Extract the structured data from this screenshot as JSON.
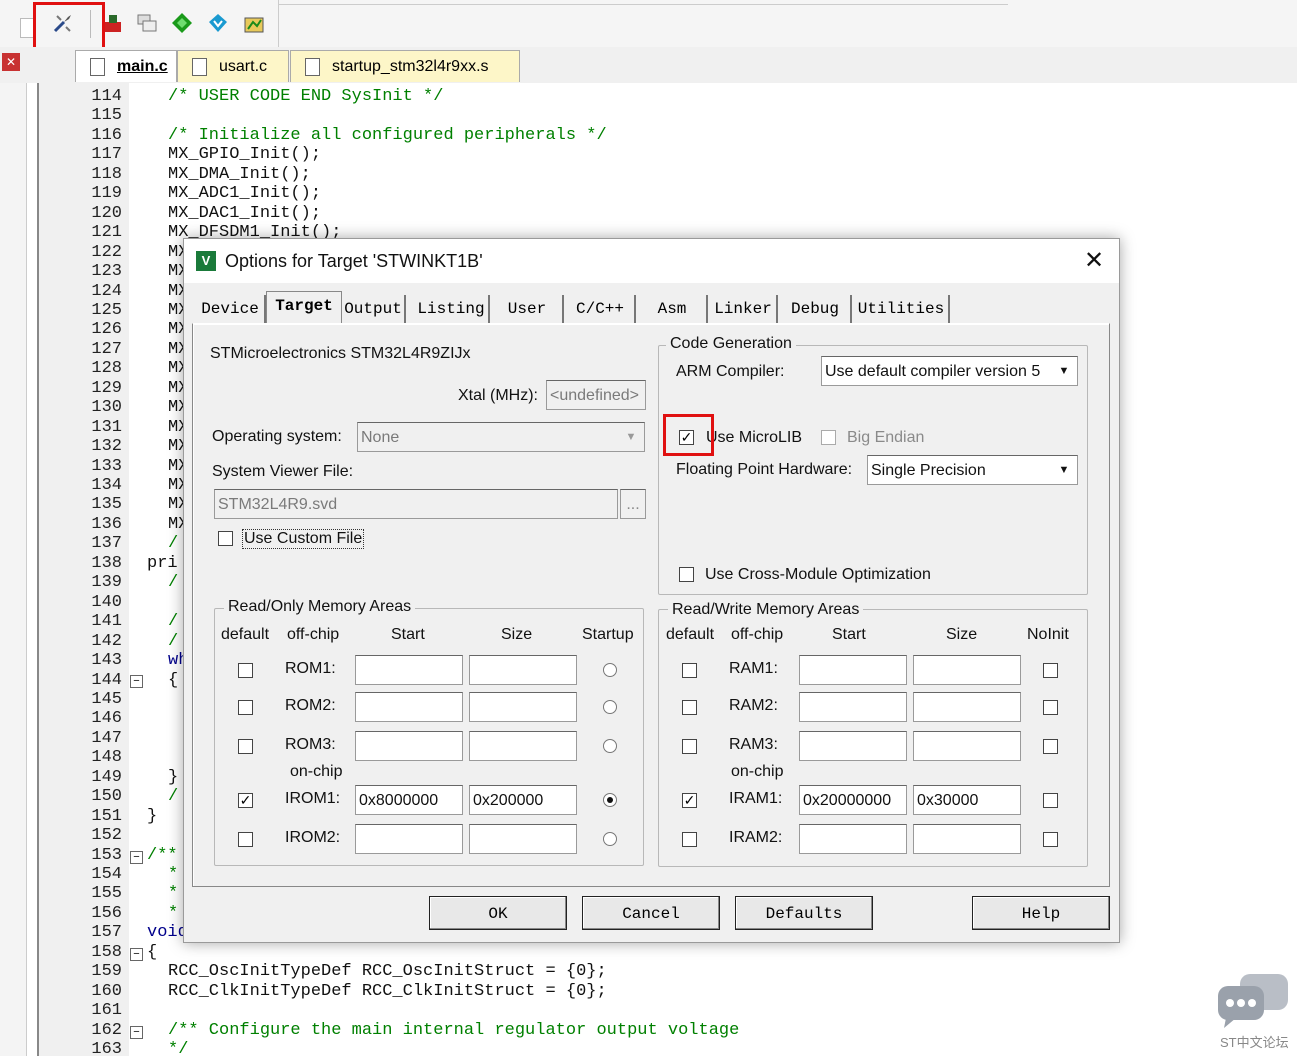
{
  "tabs": [
    {
      "label": "main.c"
    },
    {
      "label": "usart.c"
    },
    {
      "label": "startup_stm32l4r9xx.s"
    }
  ],
  "toolbar_icons": [
    "options-for-target-icon",
    "load-icon",
    "window-icon",
    "green-diamond-icon",
    "download-icon",
    "build-icon"
  ],
  "editor": {
    "lines": [
      {
        "n": "114",
        "t": "/* USER CODE END SysInit */",
        "c": "cmt"
      },
      {
        "n": "115",
        "t": "",
        "c": ""
      },
      {
        "n": "116",
        "t": "/* Initialize all configured peripherals */",
        "c": "cmt"
      },
      {
        "n": "117",
        "t": "MX_GPIO_Init();",
        "c": ""
      },
      {
        "n": "118",
        "t": "MX_DMA_Init();",
        "c": ""
      },
      {
        "n": "119",
        "t": "MX_ADC1_Init();",
        "c": ""
      },
      {
        "n": "120",
        "t": "MX_DAC1_Init();",
        "c": ""
      },
      {
        "n": "121",
        "t": "MX_DFSDM1_Init();",
        "c": ""
      },
      {
        "n": "122",
        "t": "MX",
        "c": ""
      },
      {
        "n": "123",
        "t": "MX",
        "c": ""
      },
      {
        "n": "124",
        "t": "MX",
        "c": ""
      },
      {
        "n": "125",
        "t": "MX",
        "c": ""
      },
      {
        "n": "126",
        "t": "MX",
        "c": ""
      },
      {
        "n": "127",
        "t": "MX",
        "c": ""
      },
      {
        "n": "128",
        "t": "MX",
        "c": ""
      },
      {
        "n": "129",
        "t": "MX",
        "c": ""
      },
      {
        "n": "130",
        "t": "MX",
        "c": ""
      },
      {
        "n": "131",
        "t": "MX",
        "c": ""
      },
      {
        "n": "132",
        "t": "MX",
        "c": ""
      },
      {
        "n": "133",
        "t": "MX",
        "c": ""
      },
      {
        "n": "134",
        "t": "MX",
        "c": ""
      },
      {
        "n": "135",
        "t": "MX",
        "c": ""
      },
      {
        "n": "136",
        "t": "MX",
        "c": ""
      },
      {
        "n": "137",
        "t": "/",
        "c": "cmt"
      },
      {
        "n": "138",
        "t": "pri",
        "c": "out"
      },
      {
        "n": "139",
        "t": "/",
        "c": "cmt"
      },
      {
        "n": "140",
        "t": "",
        "c": ""
      },
      {
        "n": "141",
        "t": "/",
        "c": "cmt"
      },
      {
        "n": "142",
        "t": "/",
        "c": "cmt"
      },
      {
        "n": "143",
        "t": "wh",
        "c": "kw"
      },
      {
        "n": "144",
        "t": "{",
        "c": ""
      },
      {
        "n": "145",
        "t": "",
        "c": ""
      },
      {
        "n": "146",
        "t": "",
        "c": ""
      },
      {
        "n": "147",
        "t": "",
        "c": ""
      },
      {
        "n": "148",
        "t": "",
        "c": ""
      },
      {
        "n": "149",
        "t": "}",
        "c": ""
      },
      {
        "n": "150",
        "t": "/",
        "c": "cmt"
      },
      {
        "n": "151",
        "t": "}",
        "c": "out"
      },
      {
        "n": "152",
        "t": "",
        "c": ""
      },
      {
        "n": "153",
        "t": "/**",
        "c": "cmtout"
      },
      {
        "n": "154",
        "t": "*",
        "c": "cmt"
      },
      {
        "n": "155",
        "t": "*",
        "c": "cmt"
      },
      {
        "n": "156",
        "t": "*",
        "c": "cmt"
      },
      {
        "n": "157",
        "t": "void",
        "c": "kwout"
      },
      {
        "n": "158",
        "t": "{",
        "c": "out"
      },
      {
        "n": "159",
        "t": "RCC_OscInitTypeDef RCC_OscInitStruct = {0};",
        "c": ""
      },
      {
        "n": "160",
        "t": "RCC_ClkInitTypeDef RCC_ClkInitStruct = {0};",
        "c": ""
      },
      {
        "n": "161",
        "t": "",
        "c": ""
      },
      {
        "n": "162",
        "t": "/** Configure the main internal regulator output voltage",
        "c": "cmt"
      },
      {
        "n": "163",
        "t": "*/",
        "c": "cmt"
      }
    ]
  },
  "dialog": {
    "title": "Options for Target 'STWINKT1B'",
    "tabs": [
      "Device",
      "Target",
      "Output",
      "Listing",
      "User",
      "C/C++",
      "Asm",
      "Linker",
      "Debug",
      "Utilities"
    ],
    "active_tab": "Target",
    "device": "STMicroelectronics STM32L4R9ZIJx",
    "xtal_label": "Xtal (MHz):",
    "xtal_value": "<undefined>",
    "os_label": "Operating system:",
    "os_value": "None",
    "svf_label": "System Viewer File:",
    "svf_value": "STM32L4R9.svd",
    "browse_label": "...",
    "custom_file_label": "Use Custom File",
    "codegen": {
      "title": "Code Generation",
      "compiler_label": "ARM Compiler:",
      "compiler_value": "Use default compiler version 5",
      "microlib_label": "Use MicroLIB",
      "microlib_checked": true,
      "bigendian_label": "Big Endian",
      "fpu_label": "Floating Point Hardware:",
      "fpu_value": "Single Precision",
      "crossmod_label": "Use Cross-Module Optimization"
    },
    "rom": {
      "title": "Read/Only Memory Areas",
      "headers": {
        "default": "default",
        "offchip": "off-chip",
        "start": "Start",
        "size": "Size",
        "extra": "Startup"
      },
      "onchip_label": "on-chip",
      "rows": [
        {
          "name": "ROM1:",
          "checked": false,
          "start": "",
          "size": "",
          "radio": false
        },
        {
          "name": "ROM2:",
          "checked": false,
          "start": "",
          "size": "",
          "radio": false
        },
        {
          "name": "ROM3:",
          "checked": false,
          "start": "",
          "size": "",
          "radio": false
        },
        {
          "name": "IROM1:",
          "checked": true,
          "start": "0x8000000",
          "size": "0x200000",
          "radio": true
        },
        {
          "name": "IROM2:",
          "checked": false,
          "start": "",
          "size": "",
          "radio": false
        }
      ]
    },
    "ram": {
      "title": "Read/Write Memory Areas",
      "headers": {
        "default": "default",
        "offchip": "off-chip",
        "start": "Start",
        "size": "Size",
        "extra": "NoInit"
      },
      "onchip_label": "on-chip",
      "rows": [
        {
          "name": "RAM1:",
          "checked": false,
          "start": "",
          "size": "",
          "noinit": false
        },
        {
          "name": "RAM2:",
          "checked": false,
          "start": "",
          "size": "",
          "noinit": false
        },
        {
          "name": "RAM3:",
          "checked": false,
          "start": "",
          "size": "",
          "noinit": false
        },
        {
          "name": "IRAM1:",
          "checked": true,
          "start": "0x20000000",
          "size": "0x30000",
          "noinit": false
        },
        {
          "name": "IRAM2:",
          "checked": false,
          "start": "",
          "size": "",
          "noinit": false
        }
      ]
    },
    "buttons": {
      "ok": "OK",
      "cancel": "Cancel",
      "defaults": "Defaults",
      "help": "Help"
    }
  },
  "watermark": "ST中文论坛",
  "colors": {
    "highlight": "#e01010",
    "comment": "#008000",
    "keyword": "#00008b",
    "tab_active": "#fdf6c8"
  }
}
